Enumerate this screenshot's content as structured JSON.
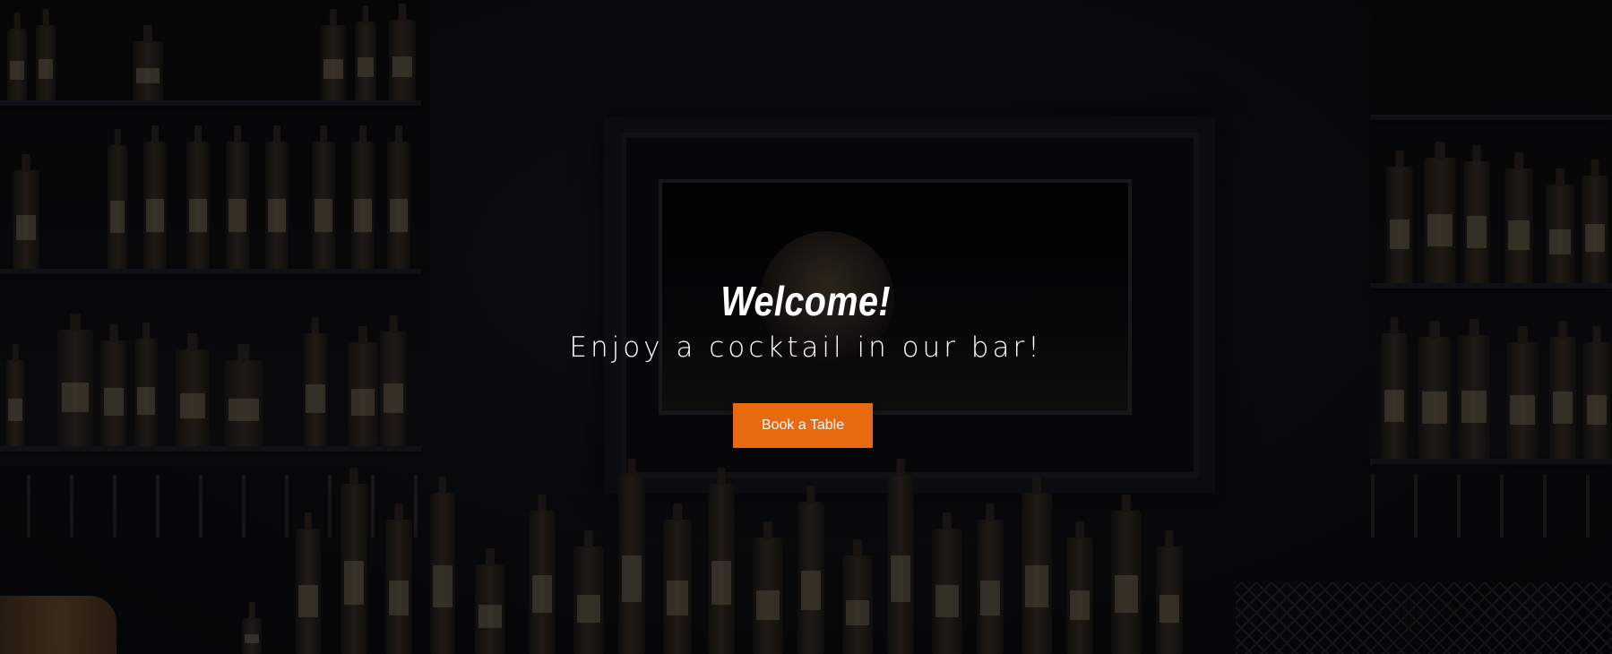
{
  "hero": {
    "title": "Welcome!",
    "subtitle": "Enjoy a cocktail in our bar!",
    "cta_label": "Book a Table",
    "accent_color": "#e76a10",
    "background_image": "bar-shelves-with-bottles"
  }
}
